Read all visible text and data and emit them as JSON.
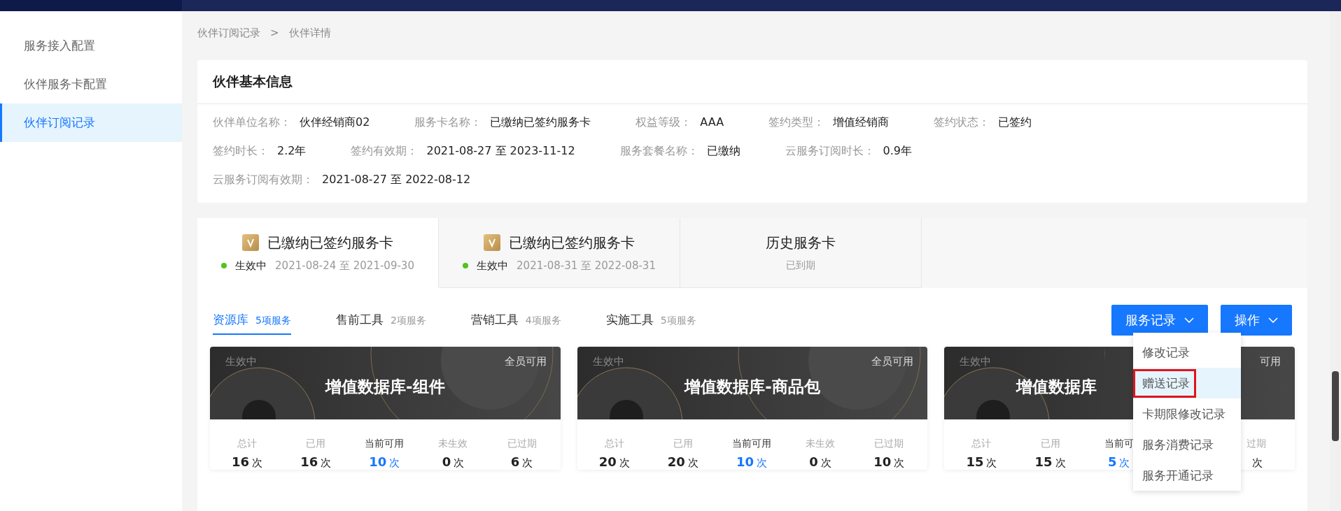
{
  "sidebar": {
    "items": [
      {
        "label": "服务接入配置",
        "selected": false
      },
      {
        "label": "伙伴服务卡配置",
        "selected": false
      },
      {
        "label": "伙伴订阅记录",
        "selected": true
      }
    ]
  },
  "breadcrumb": [
    "伙伴订阅记录",
    "伙伴详情"
  ],
  "breadcrumb_separator": ">",
  "info": {
    "title": "伙伴基本信息",
    "rows": [
      [
        {
          "label": "伙伴单位名称：",
          "value": "伙伴经销商02"
        },
        {
          "label": "服务卡名称：",
          "value": "已缴纳已签约服务卡"
        },
        {
          "label": "权益等级：",
          "value": "AAA"
        },
        {
          "label": "签约类型：",
          "value": "增值经销商"
        },
        {
          "label": "签约状态：",
          "value": "已签约"
        }
      ],
      [
        {
          "label": "签约时长：",
          "value": "2.2年"
        },
        {
          "label": "签约有效期：",
          "value": "2021-08-27 至 2023-11-12"
        },
        {
          "label": "服务套餐名称：",
          "value": "已缴纳"
        },
        {
          "label": "云服务订阅时长：",
          "value": "0.9年"
        }
      ],
      [
        {
          "label": "云服务订阅有效期：",
          "value": "2021-08-27 至 2022-08-12"
        }
      ]
    ]
  },
  "card_tabs": [
    {
      "kind": "active",
      "title": "已缴纳已签约服务卡",
      "status": "生效中",
      "period": "2021-08-24 至 2021-09-30",
      "selected": true
    },
    {
      "kind": "active",
      "title": "已缴纳已签约服务卡",
      "status": "生效中",
      "period": "2021-08-31 至 2022-08-31",
      "selected": false
    },
    {
      "kind": "history",
      "title": "历史服务卡",
      "status": "已到期",
      "selected": false
    }
  ],
  "sub_tabs": [
    {
      "label": "资源库",
      "count": "5项服务",
      "selected": true
    },
    {
      "label": "售前工具",
      "count": "2项服务",
      "selected": false
    },
    {
      "label": "营销工具",
      "count": "4项服务",
      "selected": false
    },
    {
      "label": "实施工具",
      "count": "5项服务",
      "selected": false
    }
  ],
  "buttons": [
    {
      "label": "服务记录",
      "open": true
    },
    {
      "label": "操作",
      "open": false
    }
  ],
  "dropdown": [
    {
      "label": "修改记录",
      "selected": false,
      "highlighted": false
    },
    {
      "label": "赠送记录",
      "selected": true,
      "highlighted": true
    },
    {
      "label": "卡期限修改记录",
      "selected": false,
      "highlighted": false
    },
    {
      "label": "服务消费记录",
      "selected": false,
      "highlighted": false
    },
    {
      "label": "服务开通记录",
      "selected": false,
      "highlighted": false
    }
  ],
  "services": [
    {
      "status": "生效中",
      "title": "增值数据库-组件",
      "scope": "全员可用",
      "stats": [
        {
          "label": "总计",
          "number": "16",
          "unit": "次",
          "accent": false
        },
        {
          "label": "已用",
          "number": "16",
          "unit": "次",
          "accent": false
        },
        {
          "label": "当前可用",
          "number": "10",
          "unit": "次",
          "accent": true
        },
        {
          "label": "未生效",
          "number": "0",
          "unit": "次",
          "accent": false
        },
        {
          "label": "已过期",
          "number": "6",
          "unit": "次",
          "accent": false
        }
      ]
    },
    {
      "status": "生效中",
      "title": "增值数据库-商品包",
      "scope": "全员可用",
      "stats": [
        {
          "label": "总计",
          "number": "20",
          "unit": "次",
          "accent": false
        },
        {
          "label": "已用",
          "number": "20",
          "unit": "次",
          "accent": false
        },
        {
          "label": "当前可用",
          "number": "10",
          "unit": "次",
          "accent": true
        },
        {
          "label": "未生效",
          "number": "0",
          "unit": "次",
          "accent": false
        },
        {
          "label": "已过期",
          "number": "10",
          "unit": "次",
          "accent": false
        }
      ]
    },
    {
      "status": "生效中",
      "title": "增值数据库",
      "scope": "可用",
      "stats": [
        {
          "label": "总计",
          "number": "15",
          "unit": "次",
          "accent": false
        },
        {
          "label": "已用",
          "number": "15",
          "unit": "次",
          "accent": false
        },
        {
          "label": "当前可",
          "number": "5",
          "unit": "次",
          "accent": true
        },
        {
          "label": "过期",
          "unit": "次",
          "accent": false
        }
      ]
    }
  ]
}
